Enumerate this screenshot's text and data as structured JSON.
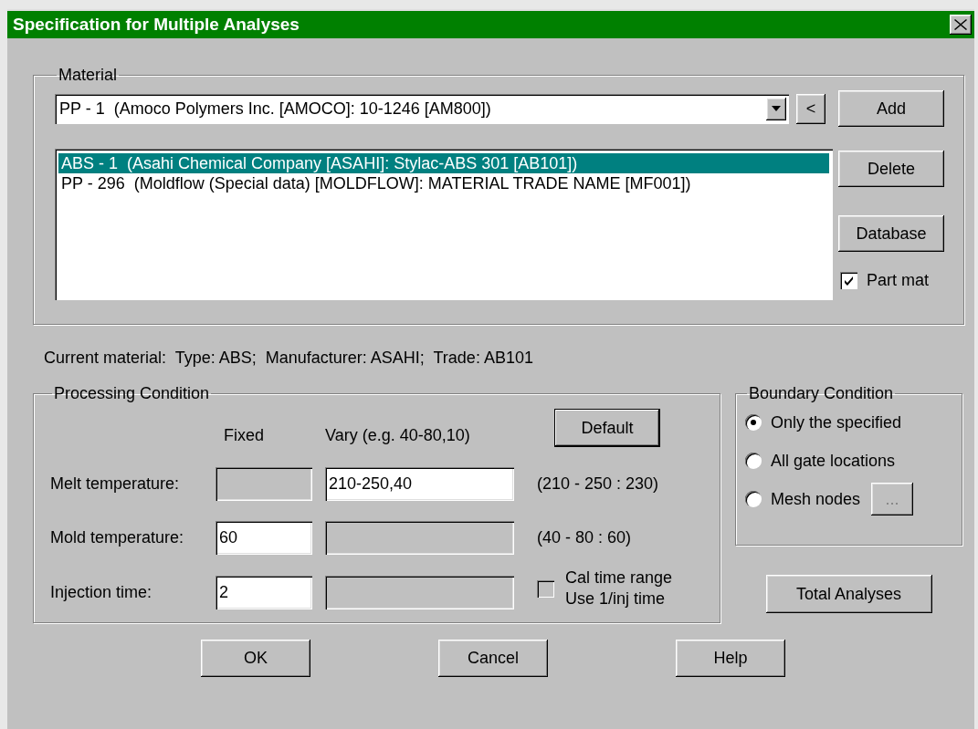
{
  "window": {
    "title": "Specification for Multiple Analyses"
  },
  "material": {
    "label": "Material",
    "combo": {
      "value": "PP - 1  (Amoco Polymers Inc. [AMOCO]: 10-1246 [AM800])"
    },
    "back_button": "<",
    "add_button": "Add",
    "list": [
      {
        "text": "ABS - 1  (Asahi Chemical Company [ASAHI]: Stylac-ABS 301 [AB101])",
        "selected": true
      },
      {
        "text": "PP - 296  (Moldflow (Special data) [MOLDFLOW]: MATERIAL TRADE NAME [MF001])",
        "selected": false
      }
    ],
    "side_buttons": [
      "Delete",
      "Database"
    ],
    "part_mat": {
      "label": "Part mat",
      "checked": true
    }
  },
  "current_material": "Current material:  Type: ABS;  Manufacturer: ASAHI;  Trade: AB101",
  "processing": {
    "label": "Processing Condition",
    "default_button": "Default",
    "column_headers": [
      "Fixed",
      "Vary (e.g. 40-80,10)"
    ],
    "rows": [
      {
        "label": "Melt temperature:",
        "fixed": {
          "disabled": true
        },
        "vary": {
          "value": "210-250,40",
          "disabled": false
        },
        "range": "(210 - 250 : 230)"
      },
      {
        "label": "Mold temperature:",
        "fixed": {
          "value": "60",
          "disabled": false
        },
        "vary": {
          "disabled": true
        },
        "range": "(40 - 80 : 60)"
      },
      {
        "label": "Injection time:",
        "fixed": {
          "value": "2",
          "disabled": false
        },
        "vary": {
          "disabled": true
        }
      }
    ],
    "cal_time": {
      "lines": [
        "Cal time range",
        "Use 1/inj time"
      ],
      "checked": false
    }
  },
  "boundary": {
    "label": "Boundary Condition",
    "options": [
      {
        "label": "Only the specified",
        "selected": true
      },
      {
        "label": "All gate locations",
        "selected": false
      },
      {
        "label": "Mesh nodes",
        "selected": false
      }
    ],
    "mesh_button": "..."
  },
  "total_button": "Total Analyses",
  "buttons": [
    "OK",
    "Cancel",
    "Help"
  ]
}
